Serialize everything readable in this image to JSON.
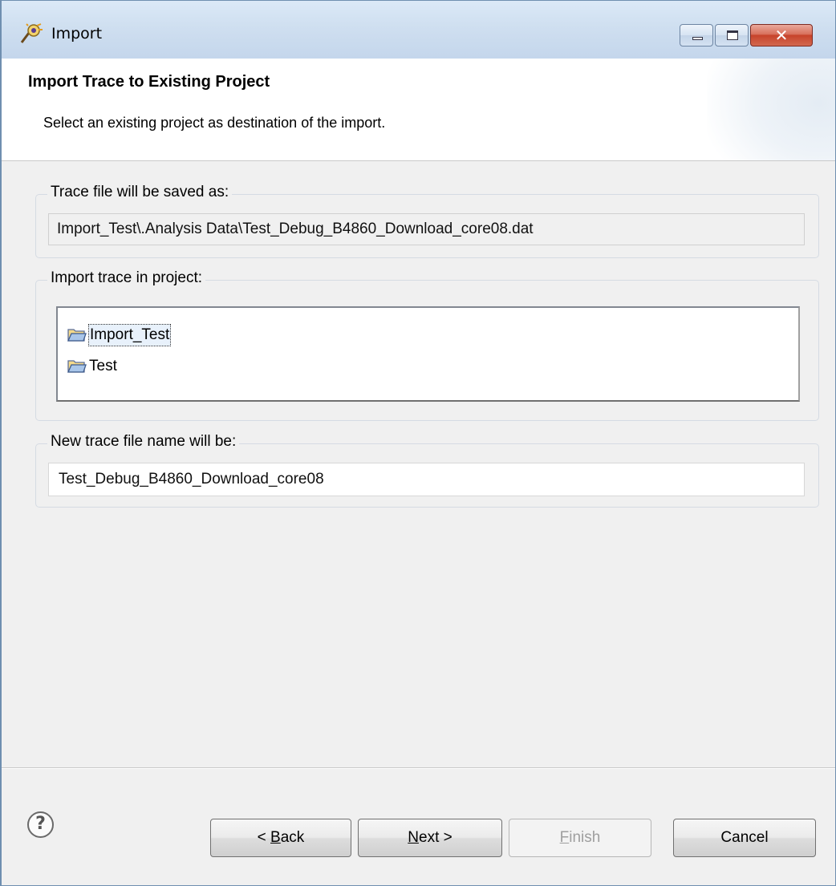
{
  "window": {
    "title": "Import",
    "icon": "eclipse-wizard-icon",
    "controls": {
      "minimize": "minimize-icon",
      "maximize": "maximize-icon",
      "close": "✕"
    }
  },
  "banner": {
    "title": "Import Trace to Existing Project",
    "description": "Select an existing project as destination of the import."
  },
  "saved_as": {
    "label": "Trace file will be saved as:",
    "value": "Import_Test\\.Analysis Data\\Test_Debug_B4860_Download_core08.dat"
  },
  "project": {
    "label": "Import trace in project:",
    "items": [
      {
        "label": "Import_Test",
        "selected": true,
        "icon": "folder-open-icon"
      },
      {
        "label": "Test",
        "selected": false,
        "icon": "folder-open-icon"
      }
    ]
  },
  "new_name": {
    "label": "New trace file name will be:",
    "value": "Test_Debug_B4860_Download_core08"
  },
  "buttons": {
    "help": "?",
    "back": {
      "prefix": "< ",
      "mnemonic": "B",
      "rest": "ack"
    },
    "next": {
      "mnemonic": "N",
      "rest": "ext >"
    },
    "finish": {
      "mnemonic": "F",
      "rest": "inish",
      "enabled": false
    },
    "cancel": "Cancel"
  },
  "colors": {
    "titlebar": "#cfdff0",
    "close_button": "#c7432b",
    "dialog_background": "#f0f0f0",
    "selection": "#e8f1fb"
  }
}
